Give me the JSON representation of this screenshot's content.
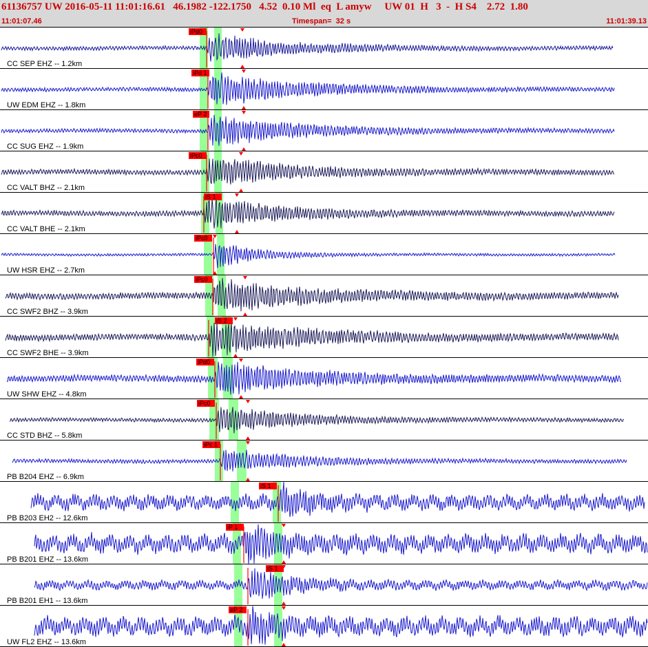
{
  "header": {
    "title": "61136757 UW 2016-05-11 11:01:16.61   46.1982 -122.1750   4.52  0.10 Ml  eq  L amyw     UW 01  H   3  -  H S4    2.72  1.80",
    "start_time": "11:01:07.46",
    "timespan": "Timespan=  32 s",
    "end_time": "11:01:39.13"
  },
  "colors": {
    "trace_blue": "#1a1acc",
    "trace_navy": "#1c1c5a",
    "pick_red": "#ff0000",
    "window_green": "#99ff99",
    "header_text": "#cc0000"
  },
  "channels": [
    {
      "label": "CC SEP EHZ -- 1.2km",
      "color": "navy_blue",
      "picks": [
        {
          "text": "iPd0"
        }
      ]
    },
    {
      "label": "UW EDM EHZ -- 1.8km",
      "color": "blue",
      "picks": [
        {
          "text": "iPd 1"
        }
      ]
    },
    {
      "label": "CC SUG EHZ -- 1.9km",
      "color": "blue",
      "picks": [
        {
          "text": "eP 2"
        }
      ]
    },
    {
      "label": "CC VALT BHZ -- 2.1km",
      "color": "navy",
      "picks": [
        {
          "text": "iPc0"
        }
      ]
    },
    {
      "label": "CC VALT BHE -- 2.1km",
      "color": "navy",
      "picks": [
        {
          "text": "iS 1"
        }
      ]
    },
    {
      "label": "UW HSR EHZ -- 2.7km",
      "color": "blue",
      "picks": [
        {
          "text": "iPc0"
        }
      ]
    },
    {
      "label": "CC SWF2 BHZ -- 3.9km",
      "color": "navy",
      "picks": [
        {
          "text": "iPc0"
        }
      ]
    },
    {
      "label": "CC SWF2 BHE -- 3.9km",
      "color": "navy",
      "picks": [
        {
          "text": "iS 2"
        }
      ]
    },
    {
      "label": "UW SHW EHZ -- 4.8km",
      "color": "blue",
      "picks": [
        {
          "text": "iPd0"
        }
      ]
    },
    {
      "label": "CC STD BHZ -- 5.8km",
      "color": "navy",
      "picks": [
        {
          "text": "iPc0"
        }
      ]
    },
    {
      "label": "PB B204 EHZ -- 6.9km",
      "color": "blue",
      "picks": [
        {
          "text": "iPc 1"
        }
      ]
    },
    {
      "label": "PB B203 EH2 -- 12.6km",
      "color": "blue",
      "picks": [
        {
          "text": "iS 1"
        }
      ]
    },
    {
      "label": "PB B201 EHZ -- 13.6km",
      "color": "blue",
      "picks": [
        {
          "text": "iP 1"
        }
      ]
    },
    {
      "label": "PB B201 EH1 -- 13.6km",
      "color": "blue",
      "picks": [
        {
          "text": "iS 1"
        }
      ]
    },
    {
      "label": "UW FL2 EHZ -- 13.6km",
      "color": "blue",
      "picks": [
        {
          "text": "eP 2"
        }
      ]
    }
  ]
}
